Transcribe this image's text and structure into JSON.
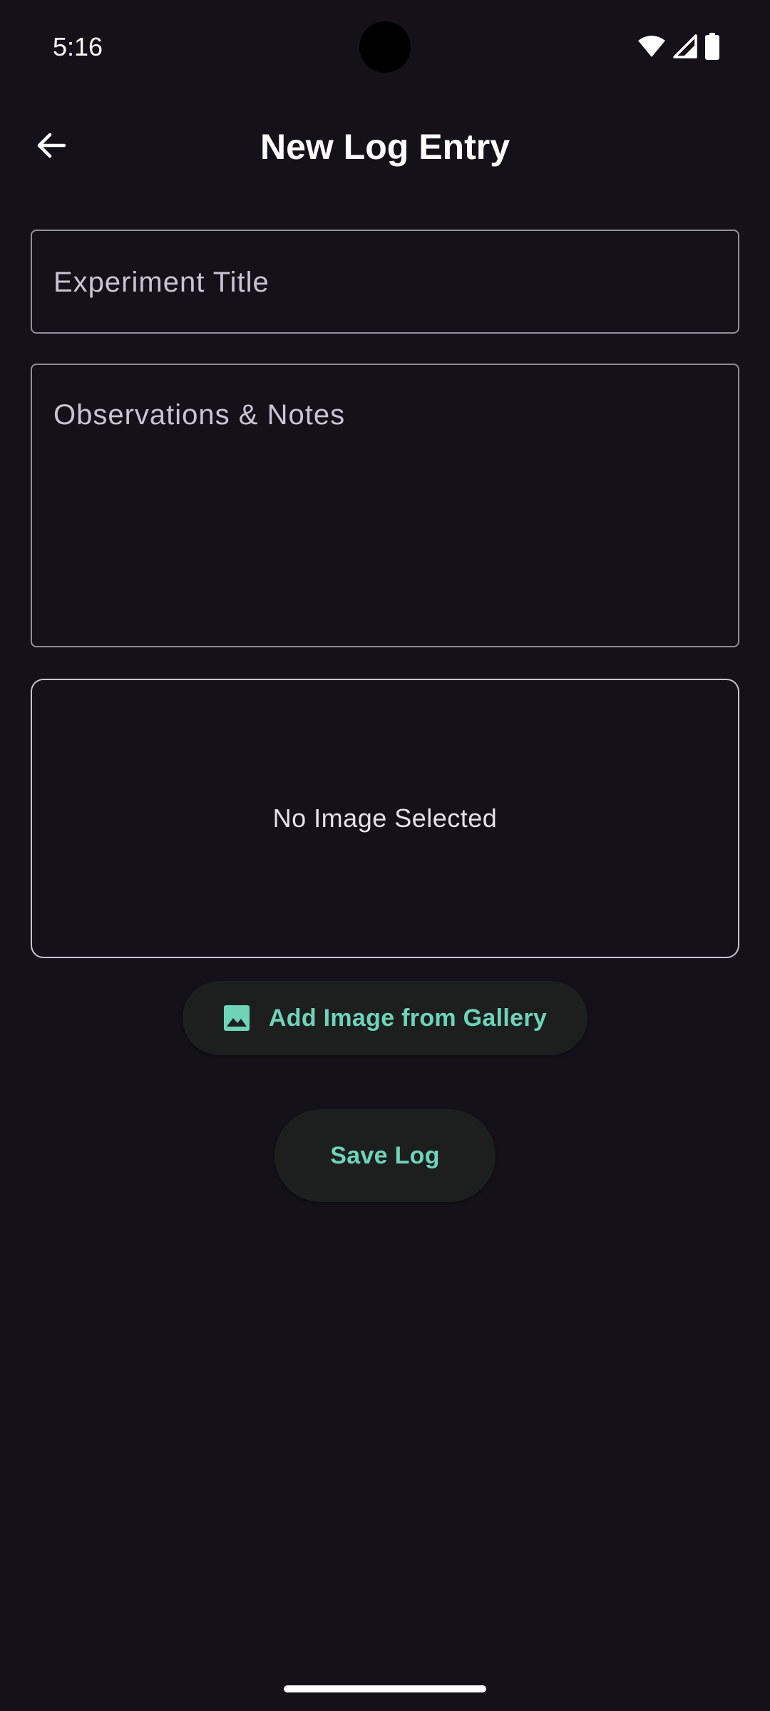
{
  "status_bar": {
    "time": "5:16",
    "icons": [
      "wifi-icon",
      "cell-signal-icon",
      "battery-icon"
    ]
  },
  "app_bar": {
    "back_icon": "arrow-back-icon",
    "title": "New Log Entry"
  },
  "form": {
    "title_field": {
      "value": "",
      "placeholder": "Experiment Title"
    },
    "notes_field": {
      "value": "",
      "placeholder": "Observations & Notes"
    },
    "image_preview": {
      "empty_text": "No Image Selected"
    },
    "gallery_button": {
      "icon": "image-icon",
      "label": "Add Image from Gallery"
    },
    "save_button": {
      "label": "Save Log"
    }
  },
  "colors": {
    "background": "#141218",
    "accent": "#6FD3B8",
    "button_surface": "#1D1F1F",
    "outline": "#938F99",
    "on_surface": "#E6E0E9"
  }
}
